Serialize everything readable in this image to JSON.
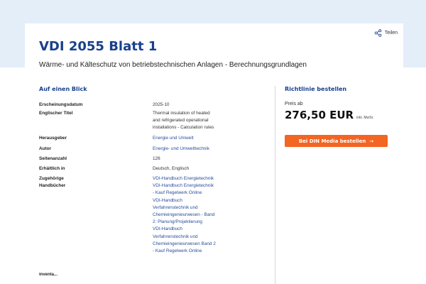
{
  "share": {
    "label": "Teilen"
  },
  "document": {
    "title": "VDI 2055 Blatt 1",
    "subtitle": "Wärme- und Kälteschutz von betriebstechnischen Anlagen - Berechnungsgrundlagen"
  },
  "glance": {
    "heading": "Auf einen Blick",
    "rows": [
      {
        "label": "Erscheinungsdatum",
        "value": [
          "2025-10"
        ]
      },
      {
        "label": "Englischer Titel",
        "value": [
          "Thermal insulation of heated",
          "and refrigerated operational",
          "installations - Calculation rules"
        ]
      },
      {
        "label": "Herausgeber",
        "value": [
          "Energie und Umwelt"
        ]
      },
      {
        "label": "Autor",
        "value": [
          "Energie- und Umwelttechnik"
        ]
      },
      {
        "label": "Seitenanzahl",
        "value": [
          "126"
        ]
      },
      {
        "label": "Erhältlich in",
        "value": [
          "Deutsch, Englisch"
        ]
      },
      {
        "label": "Zugehörige",
        "label2": "Handbücher",
        "links": [
          [
            "VDI-Handbuch Energietechnik"
          ],
          [
            "VDI-Handbuch Energietechnik",
            "- Kauf Regelwerk Online"
          ],
          [
            "VDI-Handbuch",
            "Verfahrenstechnik und",
            "Chemieingenieurwesen - Band",
            "2: Planung/Projektierung"
          ],
          [
            "VDI-Handbuch",
            "Verfahrenstechnik und",
            "Chemieingenieurwesen Band 2",
            "- Kauf Regelwerk Online"
          ]
        ]
      }
    ],
    "next_heading": "Inventa..."
  },
  "order": {
    "heading": "Richtlinie bestellen",
    "price_label": "Preis ab",
    "price": "276,50 EUR",
    "vat_note": "inkl. MwSt.",
    "button_label": "Bei DIN Media bestellen",
    "button_arrow": "→"
  },
  "colors": {
    "accent": "#18408f",
    "button": "#f26522",
    "band": "#e3eef9",
    "link": "#2a4e9b"
  }
}
